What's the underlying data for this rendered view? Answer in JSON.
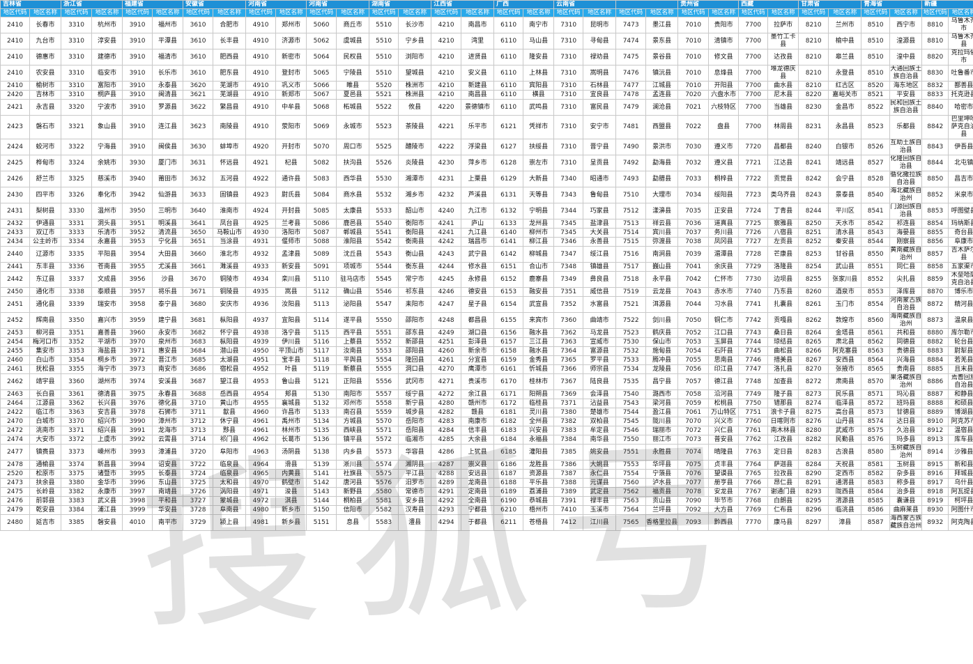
{
  "provinces": [
    "吉林省",
    "浙江省",
    "福建省",
    "安徽省",
    "河南省",
    "河南省",
    "湖南省",
    "江西省",
    "广西",
    "云南省",
    "",
    "贵州省",
    "西藏",
    "甘肃省",
    "青海省",
    "新疆"
  ],
  "header": {
    "code": "地区代码",
    "name": "地区名称"
  },
  "watermark": "搜狐号",
  "rows": [
    [
      2410,
      "长春市",
      3310,
      "杭州市",
      3910,
      "福州市",
      3610,
      "合肥市",
      4910,
      "郑州市",
      5060,
      "商丘市",
      5510,
      "长沙市",
      4210,
      "南昌市",
      6110,
      "南宁市",
      7310,
      "昆明市",
      7473,
      "墨江县",
      7010,
      "贵阳市",
      7700,
      "拉萨市",
      8210,
      "兰州市",
      8510,
      "西宁市",
      8810,
      "乌鲁木齐市"
    ],
    [
      2410,
      "九台市",
      3310,
      "淳安县",
      3910,
      "平潭县",
      3610,
      "长丰县",
      4910,
      "济源市",
      5062,
      "虞城县",
      5510,
      "宁乡县",
      4210,
      "湾里",
      6110,
      "马山县",
      7310,
      "寻甸县",
      7474,
      "景东县",
      7010,
      "清镇市",
      7700,
      "墨竹工卡县",
      8210,
      "榆中县",
      8510,
      "湟源县",
      8810,
      "乌鲁木齐县"
    ],
    [
      2410,
      "德惠市",
      3310,
      "建德市",
      3910,
      "福清市",
      3610,
      "肥西县",
      4910,
      "新密市",
      5064,
      "民权县",
      5510,
      "浏阳市",
      4210,
      "进贤县",
      6110,
      "隆安县",
      7310,
      "禄劝县",
      7475,
      "景谷县",
      7010,
      "修文县",
      7700,
      "达孜县",
      8210,
      "皋兰县",
      8510,
      "湟中县",
      8820,
      "克拉玛依市"
    ],
    [
      2410,
      "农安县",
      3310,
      "临安市",
      3910,
      "长乐市",
      3610,
      "肥东县",
      4910,
      "登封市",
      5065,
      "宁陵县",
      5510,
      "望城县",
      4210,
      "安义县",
      6110,
      "上林县",
      7310,
      "嵩明县",
      7476,
      "镇沅县",
      7010,
      "息烽县",
      7700,
      "堆龙德庆县",
      8210,
      "永登县",
      8510,
      "大通回族土族自治县",
      8830,
      "吐鲁番市"
    ],
    [
      2410,
      "榆树市",
      3310,
      "富阳市",
      3910,
      "永泰县",
      3620,
      "芜湖市",
      4910,
      "巩义市",
      5066,
      "睢县",
      5520,
      "株洲市",
      4210,
      "新建县",
      6110,
      "宾阳县",
      7310,
      "石林县",
      7477,
      "江城县",
      7010,
      "开阳县",
      7700,
      "曲水县",
      8210,
      "红古区",
      8520,
      "海东地区",
      8832,
      "鄯善县"
    ],
    [
      2420,
      "吉林市",
      3310,
      "桐庐县",
      3910,
      "闽清县",
      3621,
      "芜湖县",
      4910,
      "新郑市",
      5067,
      "夏邑县",
      5521,
      "株洲县",
      4210,
      "南昌县",
      6110,
      "横县",
      7310,
      "宜良县",
      7478,
      "孟连县",
      7020,
      "六盘水市",
      7700,
      "尼木县",
      8220,
      "嘉峪关市",
      8521,
      "平安县",
      8833,
      "托克逊县"
    ],
    [
      2421,
      "永吉县",
      3320,
      "宁波市",
      3910,
      "罗源县",
      3622,
      "繁昌县",
      4910,
      "中牟县",
      5068,
      "柘城县",
      5522,
      "攸县",
      4220,
      "景德镇市",
      6110,
      "武鸣县",
      7310,
      "富民县",
      7479,
      "澜沧县",
      7021,
      "六枝特区",
      7700,
      "当雄县",
      8230,
      "金昌市",
      8522,
      "民和回族土族自治县",
      8840,
      "哈密市"
    ],
    [
      2423,
      "磐石市",
      3321,
      "象山县",
      3910,
      "连江县",
      3623,
      "南陵县",
      4910,
      "荥阳市",
      5069,
      "永城市",
      5523,
      "茶陵县",
      4221,
      "乐平市",
      6121,
      "凭祥市",
      7310,
      "安宁市",
      7481,
      "西盟县",
      7022,
      "盘县",
      7700,
      "林周县",
      8231,
      "永昌县",
      8523,
      "乐都县",
      8842,
      "巴里坤哈萨克自治县"
    ],
    [
      2424,
      "蛟河市",
      3322,
      "宁海县",
      3910,
      "闽侯县",
      3630,
      "蚌埠市",
      4920,
      "开封市",
      5070,
      "周口市",
      5525,
      "醴陵市",
      4222,
      "浮梁县",
      6127,
      "扶绥县",
      7310,
      "晋宁县",
      7490,
      "景洪市",
      7030,
      "遵义市",
      7720,
      "昌都县",
      8240,
      "白银市",
      8526,
      "互助土族自治县",
      8843,
      "伊吾县"
    ],
    [
      2425,
      "桦甸市",
      3324,
      "余姚市",
      3930,
      "厦门市",
      3631,
      "怀远县",
      4921,
      "杞县",
      5082,
      "扶沟县",
      5526,
      "炎陵县",
      4230,
      "萍乡市",
      6128,
      "崇左市",
      7310,
      "呈贡县",
      7492,
      "勐海县",
      7032,
      "遵义县",
      7721,
      "江达县",
      8241,
      "靖远县",
      8527,
      "化隆回族自治县",
      8844,
      "北屯镇"
    ],
    [
      2426,
      "舒兰市",
      3325,
      "慈溪市",
      3940,
      "莆田市",
      3632,
      "五河县",
      4922,
      "通许县",
      5083,
      "西华县",
      5530,
      "湘潭市",
      4231,
      "上栗县",
      6129,
      "大新县",
      7340,
      "昭通市",
      7493,
      "勐腊县",
      7033,
      "桐梓县",
      7722,
      "贡觉县",
      8242,
      "会宁县",
      8528,
      "循化撒拉族自治县",
      8850,
      "昌吉市"
    ],
    [
      2430,
      "四平市",
      3326,
      "奉化市",
      3942,
      "仙游县",
      3633,
      "固镇县",
      4923,
      "尉氏县",
      5084,
      "商水县",
      5532,
      "湘乡市",
      4232,
      "芦溪县",
      6131,
      "天等县",
      7343,
      "鲁甸县",
      7510,
      "大理市",
      7034,
      "绥阳县",
      7723,
      "类乌齐县",
      8243,
      "景泰县",
      8540,
      "海北藏族自治州",
      8852,
      "米泉市"
    ],
    [
      2431,
      "梨树县",
      3330,
      "温州市",
      3950,
      "三明市",
      3640,
      "淮南市",
      4924,
      "开封县",
      5085,
      "太康县",
      5533,
      "韶山市",
      4240,
      "九江市",
      6132,
      "宁明县",
      7344,
      "巧家县",
      7512,
      "漾濞县",
      7035,
      "正安县",
      7724,
      "丁青县",
      8244,
      "平川区",
      8541,
      "门源回族自治县",
      8853,
      "呼图壁县"
    ],
    [
      2432,
      "伊通县",
      3331,
      "洞头县",
      3951,
      "明溪县",
      3641,
      "凤台县",
      4925,
      "兰考县",
      5086,
      "鹿邑县",
      5540,
      "衡阳市",
      4241,
      "庐山",
      6133,
      "龙州县",
      7345,
      "盐津县",
      7513,
      "祥云县",
      7036,
      "道真县",
      7725,
      "察雅县",
      8250,
      "天水市",
      8542,
      "祁连县",
      8854,
      "玛纳斯县"
    ],
    [
      2433,
      "双辽市",
      3333,
      "乐清市",
      3952,
      "清流县",
      3650,
      "马鞍山市",
      4930,
      "洛阳市",
      5087,
      "郸城县",
      5541,
      "衡阳县",
      4241,
      "九江县",
      6140,
      "柳州市",
      7345,
      "大关县",
      7514,
      "宾川县",
      7037,
      "务川县",
      7726,
      "八宿县",
      8251,
      "清水县",
      8543,
      "海晏县",
      8855,
      "奇台县"
    ],
    [
      2434,
      "公主岭市",
      3334,
      "永嘉县",
      3953,
      "宁化县",
      3651,
      "当涂县",
      4931,
      "偃师市",
      5088,
      "淮阳县",
      5542,
      "衡南县",
      4242,
      "瑞昌市",
      6141,
      "柳江县",
      7346,
      "永善县",
      7515,
      "弥渡县",
      7038,
      "凤冈县",
      7727,
      "左贡县",
      8252,
      "秦安县",
      8544,
      "刚察县",
      8856,
      "阜康市"
    ],
    [
      2440,
      "辽源市",
      3335,
      "平阳县",
      3954,
      "大田县",
      3660,
      "淮北市",
      4932,
      "孟津县",
      5089,
      "沈丘县",
      5543,
      "衡山县",
      4243,
      "武宁县",
      6142,
      "柳城县",
      7347,
      "绥江县",
      7516,
      "南涧县",
      7039,
      "湄潭县",
      7728,
      "芒康县",
      8253,
      "甘谷县",
      8550,
      "黄南藏族自治州",
      8857,
      "吉木萨尔县"
    ],
    [
      2441,
      "东丰县",
      3336,
      "苍南县",
      3955,
      "尤溪县",
      3661,
      "濉溪县",
      4933,
      "新安县",
      5091,
      "项城市",
      5544,
      "衡东县",
      4244,
      "修水县",
      6151,
      "合山市",
      7348,
      "镇雄县",
      7517,
      "巍山县",
      7041,
      "余庆县",
      7729,
      "洛隆县",
      8254,
      "武山县",
      8551,
      "同仁县",
      8858,
      "五家渠市"
    ],
    [
      2442,
      "东辽县",
      3337,
      "文成县",
      3956,
      "沙县",
      3670,
      "铜陵市",
      4934,
      "栾川县",
      5110,
      "驻马店市",
      5545,
      "常宁市",
      4245,
      "永修县",
      6152,
      "鹿寨县",
      7349,
      "彝良县",
      7518,
      "永平县",
      7042,
      "仁怀市",
      7730,
      "边坝县",
      8255,
      "张家川县",
      8552,
      "尖扎县",
      8859,
      "木垒哈萨克自治县"
    ],
    [
      2450,
      "通化市",
      3338,
      "泰顺县",
      3957,
      "将乐县",
      3671,
      "铜陵县",
      4935,
      "嵩县",
      5112,
      "确山县",
      5546,
      "祁东县",
      4246,
      "德安县",
      6153,
      "融安县",
      7351,
      "威信县",
      7519,
      "云龙县",
      7043,
      "赤水市",
      7740,
      "乃东县",
      8260,
      "酒泉市",
      8553,
      "泽库县",
      8870,
      "博乐市"
    ],
    [
      2451,
      "通化县",
      3339,
      "瑞安市",
      3958,
      "泰宁县",
      3680,
      "安庆市",
      4936,
      "汝阳县",
      5113,
      "泌阳县",
      5547,
      "耒阳市",
      4247,
      "星子县",
      6154,
      "武宣县",
      7352,
      "水富县",
      7521,
      "洱源县",
      7044,
      "习水县",
      7741,
      "扎囊县",
      8261,
      "玉门市",
      8554,
      "河南蒙古族自治县",
      8872,
      "精河县"
    ],
    [
      2452,
      "辉南县",
      3350,
      "嘉兴市",
      3959,
      "建宁县",
      3681,
      "枞阳县",
      4937,
      "宜阳县",
      5114,
      "遂平县",
      5550,
      "邵阳市",
      4248,
      "都昌县",
      6155,
      "来宾市",
      7360,
      "曲靖市",
      7522,
      "剑川县",
      7050,
      "铜仁市",
      7742,
      "贡嘎县",
      8262,
      "敦煌市",
      8560,
      "海南藏族自治州",
      8873,
      "温泉县"
    ],
    [
      2453,
      "柳河县",
      3351,
      "嘉善县",
      3960,
      "永安市",
      3682,
      "怀宁县",
      4938,
      "洛宁县",
      5115,
      "西平县",
      5551,
      "邵东县",
      4249,
      "湖口县",
      6156,
      "融水县",
      7362,
      "马龙县",
      7523,
      "鹤庆县",
      7052,
      "江口县",
      7743,
      "桑日县",
      8264,
      "金塔县",
      8561,
      "共和县",
      8880,
      "库尔勒市"
    ],
    [
      2454,
      "梅河口市",
      3352,
      "平湖市",
      3970,
      "泉州市",
      3683,
      "枞阳县",
      4939,
      "伊川县",
      5116,
      "上蔡县",
      5552,
      "新邵县",
      4251,
      "彭泽县",
      6157,
      "三江县",
      7363,
      "宣威市",
      7530,
      "保山市",
      7053,
      "玉屏县",
      7744,
      "琼结县",
      8265,
      "肃北县",
      8562,
      "同德县",
      8882,
      "轮台县"
    ],
    [
      2455,
      "集安市",
      3353,
      "海盐县",
      3971,
      "惠安县",
      3684,
      "潜山县",
      4950,
      "平顶山市",
      5117,
      "汝南县",
      5553,
      "邵阳县",
      4260,
      "新余市",
      6158,
      "融水县",
      7364,
      "富源县",
      7532,
      "施甸县",
      7054,
      "石阡县",
      7745,
      "曲松县",
      8266,
      "阿克塞县",
      8563,
      "贵德县",
      8883,
      "尉犁县"
    ],
    [
      2460,
      "白山市",
      3354,
      "桐乡市",
      3972,
      "晋江市",
      3685,
      "太湖县",
      4951,
      "宝丰县",
      5118,
      "平舆县",
      5554,
      "隆回县",
      4261,
      "分宜县",
      6159,
      "金秀县",
      7365,
      "罗平县",
      7533,
      "腾冲县",
      7055,
      "思南县",
      7746,
      "措美县",
      8267,
      "安西县",
      8564,
      "兴海县",
      8884,
      "若羌县"
    ],
    [
      2461,
      "抚松县",
      3355,
      "海宁市",
      3973,
      "南安市",
      3686,
      "宿松县",
      4952,
      "叶县",
      5119,
      "新蔡县",
      5555,
      "洞口县",
      4270,
      "鹰潭市",
      6161,
      "忻城县",
      7366,
      "师宗县",
      7534,
      "龙陵县",
      7056,
      "印江县",
      7747,
      "洛扎县",
      8270,
      "张掖市",
      8565,
      "贵南县",
      8885,
      "且末县"
    ],
    [
      2462,
      "靖宇县",
      3360,
      "湖州市",
      3974,
      "安溪县",
      3687,
      "望江县",
      4953,
      "鲁山县",
      5121,
      "正阳县",
      5556,
      "武冈市",
      4271,
      "贵溪市",
      6170,
      "桂林市",
      7367,
      "陆良县",
      7535,
      "昌宁县",
      7057,
      "德江县",
      7748,
      "加查县",
      8272,
      "肃南县",
      8570,
      "果洛藏族自治州",
      8886,
      "焉耆回族自治县"
    ],
    [
      2463,
      "长白县",
      3361,
      "德清县",
      3975,
      "永春县",
      3688,
      "岳西县",
      4954,
      "郏县",
      5130,
      "南阳市",
      5557,
      "绥宁县",
      4272,
      "余江县",
      6171,
      "阳朔县",
      7369,
      "会泽县",
      7540,
      "潞西市",
      7058,
      "沿河县",
      7749,
      "隆子县",
      8273,
      "民乐县",
      8571,
      "玛沁县",
      8887,
      "和静县"
    ],
    [
      2464,
      "江源县",
      3362,
      "长兴县",
      3976,
      "德化县",
      3710,
      "黄山市",
      4955,
      "襄城县",
      5132,
      "邓州市",
      5558,
      "新宁县",
      4280,
      "赣州市",
      6172,
      "临桂县",
      7371,
      "沾益县",
      7543,
      "梁河县",
      7059,
      "松桃县",
      7750,
      "错那县",
      8274,
      "临泽县",
      8572,
      "班玛县",
      8888,
      "和硕县"
    ],
    [
      2422,
      "临江市",
      3363,
      "安吉县",
      3978,
      "石狮市",
      3711,
      "歙县",
      4960,
      "许昌市",
      5133,
      "南召县",
      5559,
      "城步县",
      4282,
      "赣县",
      6181,
      "灵川县",
      7380,
      "楚雄市",
      7544,
      "盈江县",
      7061,
      "万山特区",
      7751,
      "浪卡子县",
      8275,
      "高台县",
      8573,
      "甘德县",
      8889,
      "博湖县"
    ],
    [
      2470,
      "白城市",
      3370,
      "绍兴市",
      3990,
      "漳州市",
      3712,
      "休宁县",
      4961,
      "禹州市",
      5134,
      "方城县",
      5570,
      "岳阳市",
      4283,
      "南康市",
      6182,
      "全州县",
      7382,
      "双柏县",
      7545,
      "陇川县",
      7070,
      "兴义市",
      7760,
      "日喀则市",
      8276,
      "山丹县",
      8574,
      "达日县",
      8910,
      "阿克苏市"
    ],
    [
      2472,
      "洮南市",
      3371,
      "绍兴县",
      3991,
      "龙海市",
      3713,
      "黟县",
      4961,
      "林州市",
      5135,
      "西峡县",
      5571,
      "岳阳县",
      4284,
      "信丰县",
      6183,
      "兴安县",
      7383,
      "牟定县",
      7546,
      "瑞丽市",
      7072,
      "兴仁县",
      7761,
      "南木林县",
      8280,
      "武威市",
      8575,
      "久治县",
      8912,
      "温宿县"
    ],
    [
      2474,
      "大安市",
      3372,
      "上虞市",
      3992,
      "云霄县",
      3714,
      "祁门县",
      4962,
      "长葛市",
      5136,
      "镇平县",
      5572,
      "临湘市",
      4285,
      "大余县",
      6184,
      "永福县",
      7384,
      "南华县",
      7550,
      "丽江市",
      7073,
      "普安县",
      7762,
      "江孜县",
      8282,
      "民勤县",
      8576,
      "玛多县",
      8913,
      "库车县"
    ],
    [
      2477,
      "镇赉县",
      3373,
      "嵊州市",
      3993,
      "漳浦县",
      3720,
      "阜阳市",
      4963,
      "汤阴县",
      5138,
      "内乡县",
      5573,
      "华容县",
      4286,
      "上犹县",
      6185,
      "灌阳县",
      7385,
      "姚安县",
      7551,
      "永胜县",
      7074,
      "晴隆县",
      7763,
      "定日县",
      8283,
      "古浪县",
      8580,
      "玉树藏族自治州",
      8914,
      "沙雅县"
    ],
    [
      2478,
      "通榆县",
      3374,
      "新昌县",
      3994,
      "诏安县",
      3722,
      "临泉县",
      4964,
      "滑县",
      5139,
      "淅川县",
      5574,
      "湘阴县",
      4287,
      "崇义县",
      6186,
      "龙胜县",
      7386,
      "大姚县",
      7553,
      "华坪县",
      7075,
      "贞丰县",
      7764,
      "萨迦县",
      8284,
      "天祝县",
      8581,
      "玉树县",
      8915,
      "新和县"
    ],
    [
      2520,
      "松原市",
      3375,
      "诸暨市",
      3995,
      "长泰县",
      3724,
      "临泉县",
      4965,
      "内黄县",
      5141,
      "社旗县",
      5575,
      "平江县",
      4288,
      "安远县",
      6187,
      "资源县",
      7387,
      "永仁县",
      7554,
      "宁蒗县",
      7076,
      "望谟县",
      7765,
      "拉孜县",
      8290,
      "定西市",
      8582,
      "杂多县",
      8916,
      "拜城县"
    ],
    [
      2473,
      "扶余县",
      3380,
      "金华市",
      3996,
      "东山县",
      3725,
      "太和县",
      4970,
      "鹤壁市",
      5142,
      "唐河县",
      5576,
      "汨罗市",
      4289,
      "龙南县",
      6188,
      "平乐县",
      7388,
      "元谋县",
      7560,
      "泸水县",
      7077,
      "册亨县",
      7766,
      "昂仁县",
      8291,
      "通渭县",
      8583,
      "称多县",
      8917,
      "乌什县"
    ],
    [
      2475,
      "长岭县",
      3382,
      "永康市",
      3997,
      "南靖县",
      3726,
      "涡阳县",
      4971,
      "浚县",
      5143,
      "新野县",
      5580,
      "常德市",
      4291,
      "定南县",
      6189,
      "荔浦县",
      7389,
      "武定县",
      7562,
      "福贡县",
      7078,
      "安龙县",
      7767,
      "谢通门县",
      8293,
      "陇西县",
      8584,
      "治多县",
      8918,
      "阿瓦提县"
    ],
    [
      2476,
      "前郭县",
      3383,
      "武义县",
      3998,
      "平和县",
      3727,
      "蒙城县",
      4972,
      "淇县",
      5144,
      "桐柏县",
      5581,
      "安乡县",
      4292,
      "全南县",
      6190,
      "恭城县",
      7391,
      "禄丰县",
      7563,
      "贡山县",
      7090,
      "毕节市",
      7768,
      "白朗县",
      8295,
      "渭源县",
      8585,
      "囊谦县",
      8919,
      "柯坪县"
    ],
    [
      2479,
      "乾安县",
      3384,
      "浦江县",
      3999,
      "华安县",
      3728,
      "阜南县",
      4980,
      "新乡市",
      5150,
      "信阳市",
      5582,
      "汉寿县",
      4293,
      "宁都县",
      6210,
      "梧州市",
      7410,
      "玉溪市",
      7564,
      "兰坪县",
      7092,
      "大方县",
      7769,
      "仁布县",
      8296,
      "临洮县",
      8586,
      "曲麻莱县",
      8930,
      "阿图什市"
    ],
    [
      2480,
      "延吉市",
      3385,
      "磐安县",
      4010,
      "南平市",
      3729,
      "颍上县",
      4981,
      "新乡县",
      5151,
      "息县",
      5583,
      "澧县",
      4294,
      "于都县",
      6211,
      "苍梧县",
      7412,
      "江川县",
      7565,
      "香格里拉县",
      7093,
      "黔西县",
      7770,
      "康马县",
      8297,
      "漳县",
      8587,
      "海西蒙古族藏族自治州",
      8932,
      "阿克陶县"
    ]
  ]
}
